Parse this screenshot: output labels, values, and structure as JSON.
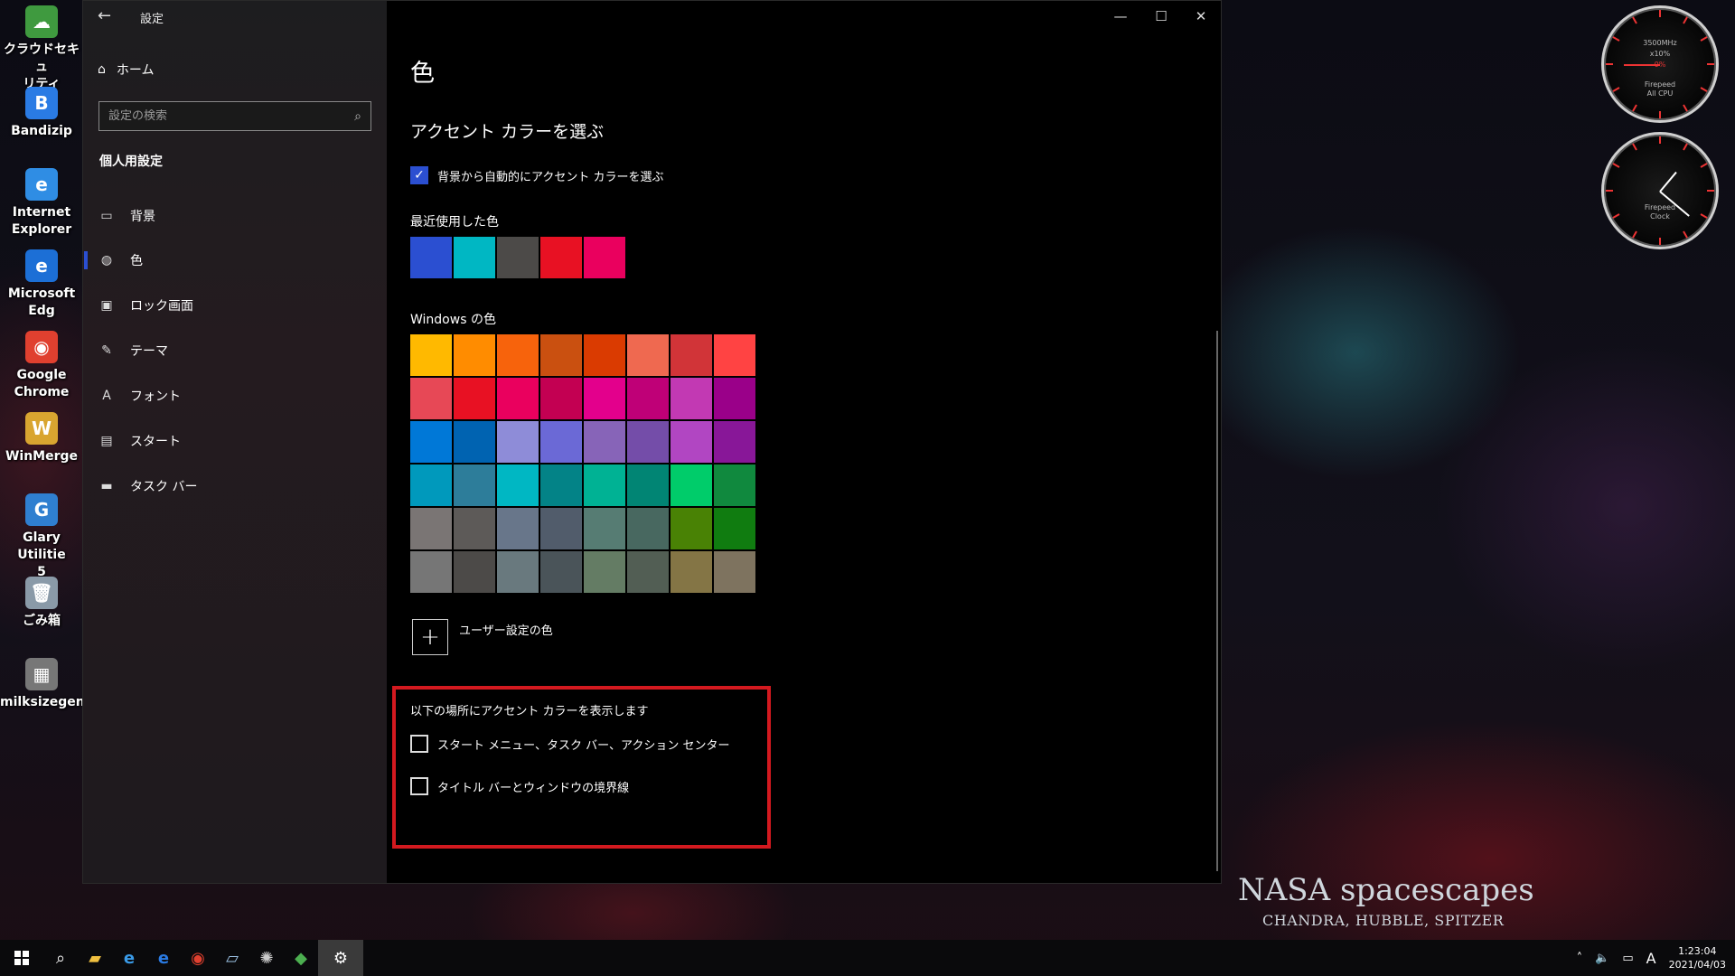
{
  "desktop": {
    "icons": [
      {
        "label": "クラウドセキュ\nリティ",
        "color": "#3f9a3f",
        "glyph": "☁"
      },
      {
        "label": "Bandizip",
        "color": "#2a7be4",
        "glyph": "B"
      },
      {
        "label": "Internet\nExplorer",
        "color": "#2f8de4",
        "glyph": "e"
      },
      {
        "label": "Microsoft Edg",
        "color": "#1c6fd6",
        "glyph": "e"
      },
      {
        "label": "Google\nChrome",
        "color": "#e0402f",
        "glyph": "◉"
      },
      {
        "label": "WinMerge",
        "color": "#d9a530",
        "glyph": "W"
      },
      {
        "label": "Glary Utilitie\n5",
        "color": "#2f7fd0",
        "glyph": "G"
      },
      {
        "label": "ごみ箱",
        "color": "#8a9aa8",
        "glyph": "🗑"
      },
      {
        "label": "milksizegen",
        "color": "#777777",
        "glyph": "▦"
      }
    ],
    "wallpaper_title": "NASA spacescapes",
    "wallpaper_subtitle": "CHANDRA, HUBBLE, SPITZER"
  },
  "gauges": {
    "cpu": {
      "top": "3500MHz",
      "mid": "x10%",
      "value": "0%",
      "brand": "Firepeed",
      "label": "All CPU"
    },
    "clock": {
      "brand": "Firepeed",
      "label": "Clock"
    }
  },
  "window": {
    "title": "設定",
    "back_icon": "back-arrow-icon",
    "minimize": "—",
    "maximize": "☐",
    "close": "✕"
  },
  "nav": {
    "home": "ホーム",
    "search_placeholder": "設定の検索",
    "section": "個人用設定",
    "items": [
      {
        "label": "背景",
        "icon": "image-icon",
        "glyph": "▭"
      },
      {
        "label": "色",
        "icon": "palette-icon",
        "glyph": "◍"
      },
      {
        "label": "ロック画面",
        "icon": "lock-screen-icon",
        "glyph": "▣"
      },
      {
        "label": "テーマ",
        "icon": "theme-icon",
        "glyph": "✎"
      },
      {
        "label": "フォント",
        "icon": "font-icon",
        "glyph": "A"
      },
      {
        "label": "スタート",
        "icon": "start-icon",
        "glyph": "▤"
      },
      {
        "label": "タスク バー",
        "icon": "taskbar-icon",
        "glyph": "▬"
      }
    ],
    "active_index": 1
  },
  "main": {
    "page_title": "色",
    "accent_heading": "アクセント カラーを選ぶ",
    "auto_accent_label": "背景から自動的にアクセント カラーを選ぶ",
    "auto_accent_checked": true,
    "recent_label": "最近使用した色",
    "recent_colors": [
      "#2b4fd1",
      "#00b7c3",
      "#4c4a48",
      "#e81123",
      "#ea005e"
    ],
    "windows_label": "Windows の色",
    "windows_colors": [
      "#ffb900",
      "#ff8c00",
      "#f7630c",
      "#ca5010",
      "#da3b01",
      "#ef6950",
      "#d13438",
      "#ff4343",
      "#e74856",
      "#e81123",
      "#ea005e",
      "#c30052",
      "#e3008c",
      "#bf0077",
      "#c239b3",
      "#9a0089",
      "#0078d7",
      "#0063b1",
      "#8e8cd8",
      "#6b69d6",
      "#8764b8",
      "#744da9",
      "#b146c2",
      "#881798",
      "#0099bc",
      "#2d7d9a",
      "#00b7c3",
      "#038387",
      "#00b294",
      "#018574",
      "#00cc6a",
      "#10893e",
      "#7a7574",
      "#5d5a58",
      "#68768a",
      "#515c6b",
      "#567c73",
      "#486860",
      "#498205",
      "#107c10",
      "#767676",
      "#4c4a48",
      "#69797e",
      "#4a5459",
      "#647c64",
      "#525e54",
      "#847545",
      "#7e735f"
    ],
    "custom_color_label": "ユーザー設定の色",
    "show_accent_label": "以下の場所にアクセント カラーを表示します",
    "show_accent_options": [
      {
        "label": "スタート メニュー、タスク バー、アクション センター",
        "checked": false
      },
      {
        "label": "タイトル バーとウィンドウの境界線",
        "checked": false
      }
    ]
  },
  "taskbar": {
    "time": "1:23:04",
    "date": "2021/04/03",
    "ime": "A"
  }
}
